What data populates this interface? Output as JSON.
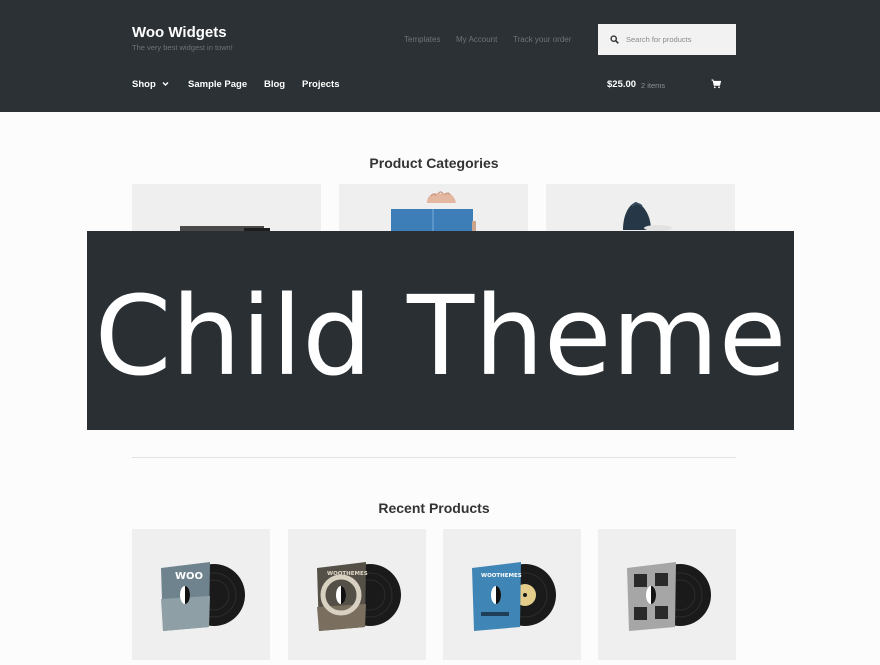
{
  "header": {
    "site_title": "Woo Widgets",
    "tagline": "The very best widgest in town!",
    "secondary_nav": [
      "Templates",
      "My Account",
      "Track your order"
    ],
    "search_placeholder": "Search for products",
    "primary_nav": [
      "Shop",
      "Sample Page",
      "Blog",
      "Projects"
    ],
    "cart": {
      "total": "$25.00",
      "count": "2 items"
    }
  },
  "main": {
    "categories_title": "Product Categories",
    "overlay_text": "Child Theme",
    "recent_title": "Recent Products",
    "record_labels": [
      "WOO",
      "WOOTHEMES",
      "WOOTHEMES",
      ""
    ]
  },
  "colors": {
    "header_bg": "#2b3135",
    "overlay_bg": "#292f33",
    "page_bg": "#fcfcfc",
    "tile_bg": "#efefef"
  }
}
